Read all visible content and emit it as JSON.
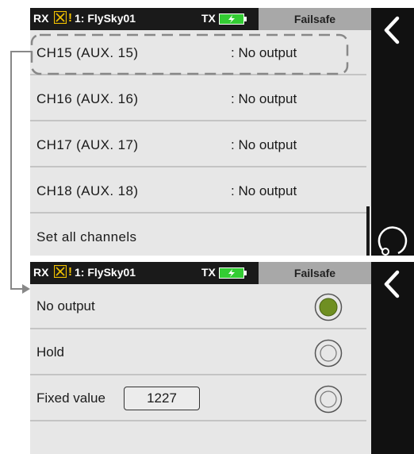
{
  "top_screen": {
    "status": {
      "rx_label": "RX",
      "warning_glyph": "!",
      "model_name": "1: FlySky01",
      "tx_label": "TX",
      "battery_icon": "battery-charging-icon",
      "screen_title": "Failsafe"
    },
    "channels": [
      {
        "label": "CH15  (AUX. 15)",
        "value": ": No output"
      },
      {
        "label": "CH16  (AUX. 16)",
        "value": ": No output"
      },
      {
        "label": "CH17  (AUX. 17)",
        "value": ": No output"
      },
      {
        "label": "CH18  (AUX. 18)",
        "value": ": No output"
      }
    ],
    "set_all_label": "Set all channels"
  },
  "bottom_screen": {
    "status": {
      "rx_label": "RX",
      "warning_glyph": "!",
      "model_name": "1: FlySky01",
      "tx_label": "TX",
      "screen_title": "Failsafe"
    },
    "options": [
      {
        "label": "No output",
        "selected": true
      },
      {
        "label": "Hold",
        "selected": false
      },
      {
        "label": "Fixed value",
        "selected": false
      }
    ],
    "fixed_value": "1227"
  },
  "colors": {
    "accent_green": "#6f8f22",
    "battery_green": "#33cc33",
    "warning_yellow": "#f2c200",
    "panel_bg": "#e7e7e7",
    "statusbar_bg": "#1a1a1a",
    "title_tab_bg": "#a8a8a8"
  }
}
